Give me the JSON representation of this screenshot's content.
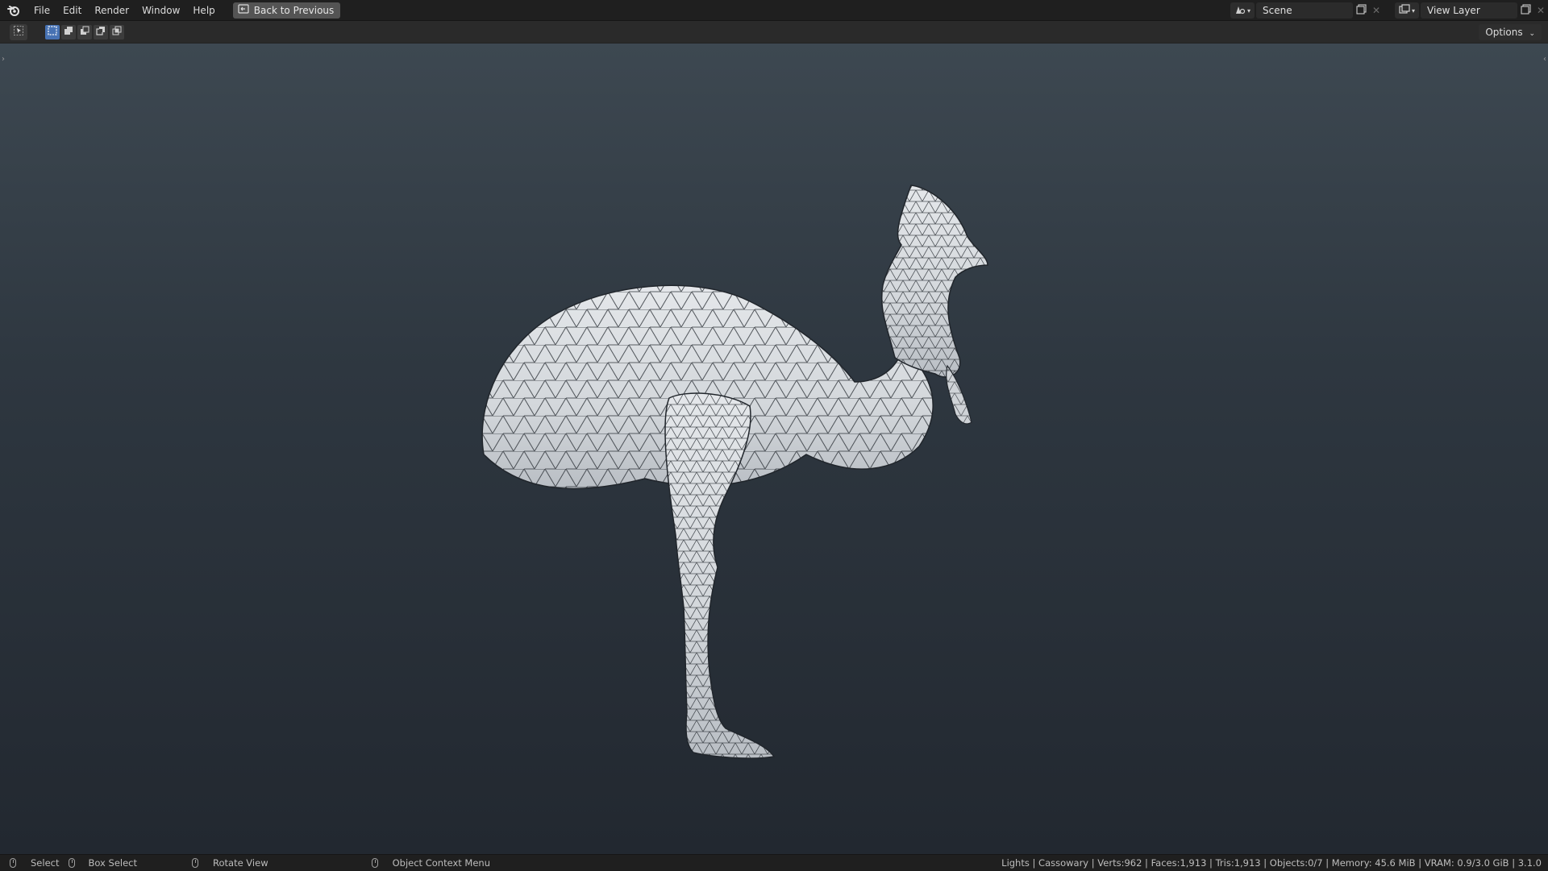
{
  "topbar": {
    "menu": [
      "File",
      "Edit",
      "Render",
      "Window",
      "Help"
    ],
    "back_button": "Back to Previous",
    "scene_name": "Scene",
    "view_layer_name": "View Layer"
  },
  "header": {
    "options_label": "Options"
  },
  "statusbar": {
    "hint_select": "Select",
    "hint_box_select": "Box Select",
    "hint_rotate": "Rotate View",
    "hint_context_menu": "Object Context Menu",
    "stats": "Lights | Cassowary | Verts:962 | Faces:1,913 | Tris:1,913 | Objects:0/7 | Memory: 45.6 MiB | VRAM: 0.9/3.0 GiB | 3.1.0"
  },
  "colors": {
    "accent_blue": "#4772b3",
    "viewport_top": "#3d4851",
    "viewport_bottom": "#222830",
    "model_fill": "#d9dcdf",
    "wire": "#2a2f35"
  },
  "icons": {
    "logo": "blender-logo-icon",
    "back": "back-screen-icon",
    "scene": "scene-icon",
    "view_layer": "view-layer-icon",
    "new": "duplicate-icon",
    "remove": "close-icon"
  }
}
